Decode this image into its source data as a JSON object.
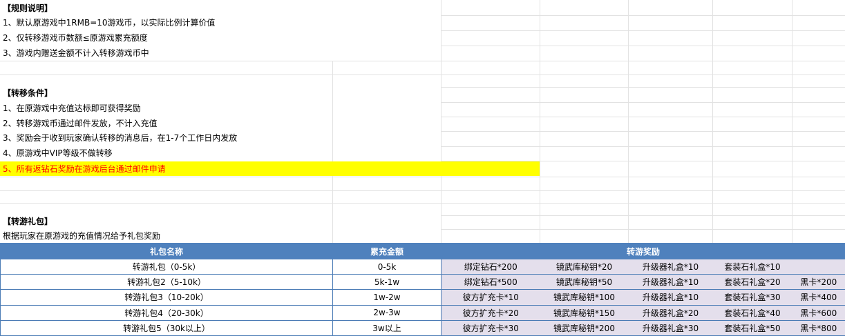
{
  "rules": {
    "title": "【规则说明】",
    "items": [
      "1、默认原游戏中1RMB=10游戏币，以实际比例计算价值",
      "2、仅转移游戏币数额≤原游戏累充额度",
      "3、游戏内赠送金额不计入转移游戏币中"
    ]
  },
  "conditions": {
    "title": "【转移条件】",
    "items": [
      "1、在原游戏中充值达标即可获得奖励",
      "2、转移游戏币通过邮件发放，不计入充值",
      "3、奖励会于收到玩家确认转移的消息后，在1-7个工作日内发放",
      "4、原游戏中VIP等级不做转移"
    ],
    "highlight": "5、所有返钻石奖励在游戏后台通过邮件申请"
  },
  "gift": {
    "title": "【转游礼包】",
    "desc": "根据玩家在原游戏的充值情况给予礼包奖励",
    "headers": [
      "礼包名称",
      "累充金额",
      "转游奖励"
    ],
    "rows": [
      {
        "name": "转游礼包（0-5k）",
        "amount": "0-5k",
        "rewards": [
          "绑定钻石*200",
          "镜武库秘钥*20",
          "升级器礼盒*10",
          "套装石礼盒*10",
          ""
        ]
      },
      {
        "name": "转游礼包2（5-10k）",
        "amount": "5k-1w",
        "rewards": [
          "绑定钻石*500",
          "镜武库秘钥*50",
          "升级器礼盒*10",
          "套装石礼盒*20",
          "黑卡*200"
        ]
      },
      {
        "name": "转游礼包3（10-20k）",
        "amount": "1w-2w",
        "rewards": [
          "彼方扩充卡*10",
          "镜武库秘钥*100",
          "升级器礼盒*10",
          "套装石礼盒*30",
          "黑卡*400"
        ]
      },
      {
        "name": "转游礼包4（20-30k）",
        "amount": "2w-3w",
        "rewards": [
          "彼方扩充卡*20",
          "镜武库秘钥*150",
          "升级器礼盒*20",
          "套装石礼盒*40",
          "黑卡*600"
        ]
      },
      {
        "name": "转游礼包5（30k以上）",
        "amount": "3w以上",
        "rewards": [
          "彼方扩充卡*30",
          "镜武库秘钥*200",
          "升级器礼盒*30",
          "套装石礼盒*50",
          "黑卡*800"
        ]
      }
    ]
  },
  "colors": {
    "header_bg": "#4f81bd",
    "reward_bg": "#e4dfec",
    "highlight_bg": "#ffff00",
    "highlight_text": "#ff0000"
  }
}
